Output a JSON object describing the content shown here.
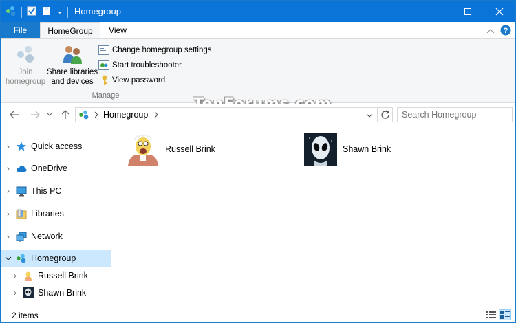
{
  "window": {
    "title": "Homegroup"
  },
  "ribbon_tabs": {
    "file": "File",
    "homegroup": "HomeGroup",
    "view": "View"
  },
  "ribbon": {
    "join": {
      "line1": "Join",
      "line2": "homegroup"
    },
    "share": {
      "line1": "Share libraries",
      "line2": "and devices"
    },
    "commands": [
      {
        "label": "Change homegroup settings",
        "icon": "settings-window-icon"
      },
      {
        "label": "Start troubleshooter",
        "icon": "troubleshooter-icon"
      },
      {
        "label": "View password",
        "icon": "key-icon"
      }
    ],
    "group_label": "Manage"
  },
  "watermark": "TenForums.com",
  "address": {
    "location": "Homegroup"
  },
  "search": {
    "placeholder": "Search Homegroup"
  },
  "nav_pane": {
    "items": [
      {
        "label": "Quick access",
        "icon": "star-icon"
      },
      {
        "label": "OneDrive",
        "icon": "cloud-icon"
      },
      {
        "label": "This PC",
        "icon": "computer-icon"
      },
      {
        "label": "Libraries",
        "icon": "libraries-icon"
      },
      {
        "label": "Network",
        "icon": "network-icon"
      },
      {
        "label": "Homegroup",
        "icon": "homegroup-icon",
        "selected": true,
        "expanded": true
      },
      {
        "label": "Russell Brink",
        "icon": "user-avatar-icon"
      },
      {
        "label": "Shawn Brink",
        "icon": "user-avatar-icon"
      }
    ]
  },
  "content": {
    "items": [
      {
        "name": "Russell Brink"
      },
      {
        "name": "Shawn Brink"
      }
    ]
  },
  "status": {
    "items": "2 items"
  },
  "colors": {
    "title_bar": "#0a74d9",
    "file_tab": "#1979ca",
    "selection": "#cce8ff"
  }
}
